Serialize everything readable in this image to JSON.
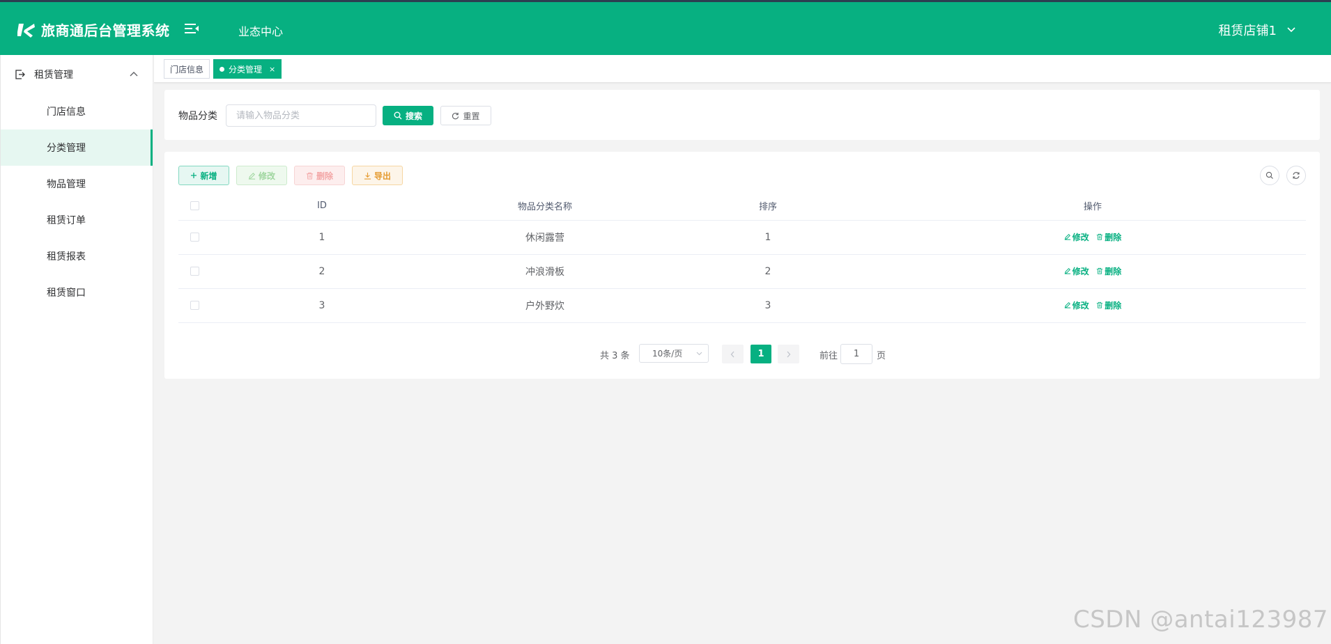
{
  "header": {
    "app_title": "旅商通后台管理系统",
    "nav_item": "业态中心",
    "shop_name": "租赁店铺1"
  },
  "sidebar": {
    "group_label": "租赁管理",
    "items": [
      {
        "label": "门店信息"
      },
      {
        "label": "分类管理"
      },
      {
        "label": "物品管理"
      },
      {
        "label": "租赁订单"
      },
      {
        "label": "租赁报表"
      },
      {
        "label": "租赁窗口"
      }
    ]
  },
  "tabs": [
    {
      "label": "门店信息"
    },
    {
      "label": "分类管理",
      "close": "×"
    }
  ],
  "search": {
    "label": "物品分类",
    "placeholder": "请输入物品分类",
    "search_btn": "搜索",
    "reset_btn": "重置"
  },
  "toolbar": {
    "add": "新增",
    "edit": "修改",
    "delete": "删除",
    "export": "导出"
  },
  "table": {
    "columns": [
      "ID",
      "物品分类名称",
      "排序",
      "操作"
    ],
    "rows": [
      {
        "id": "1",
        "name": "休闲露营",
        "sort": "1"
      },
      {
        "id": "2",
        "name": "冲浪滑板",
        "sort": "2"
      },
      {
        "id": "3",
        "name": "户外野炊",
        "sort": "3"
      }
    ],
    "row_edit": "修改",
    "row_delete": "删除"
  },
  "pagination": {
    "total": "共 3 条",
    "page_size": "10条/页",
    "current": "1",
    "goto_label": "前往",
    "goto_value": "1",
    "page_suffix": "页"
  },
  "watermark": "CSDN @antai123987",
  "colors": {
    "brand": "#07b081",
    "danger": "#f56c6c",
    "warning": "#e59a2e"
  }
}
